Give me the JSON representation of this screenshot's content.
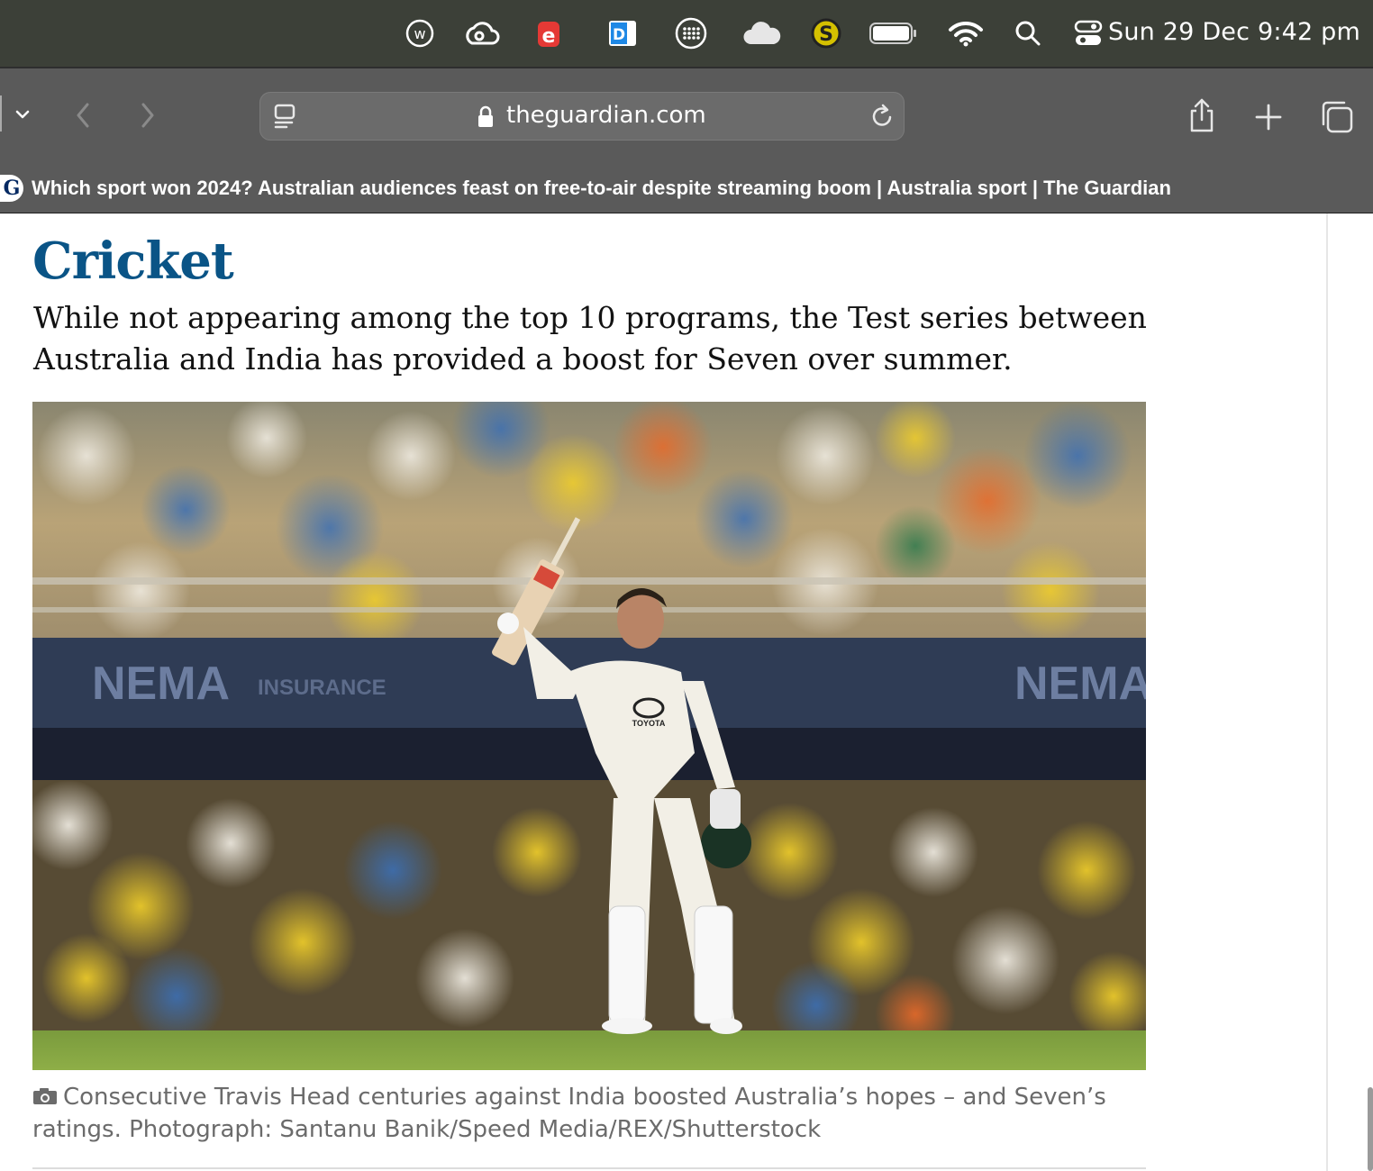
{
  "menubar": {
    "clock": "Sun 29 Dec  9:42 pm",
    "icons": [
      "w-app-icon",
      "creative-cloud-icon",
      "e-app-icon",
      "dashlane-icon",
      "dots-grid-icon",
      "cloud-icon",
      "s-app-icon",
      "battery-icon",
      "wifi-icon",
      "search-icon",
      "control-center-icon"
    ]
  },
  "toolbar": {
    "url": "theguardian.com"
  },
  "tab": {
    "favicon_letter": "G",
    "title": "Which sport won 2024? Australian audiences feast on free-to-air despite streaming boom | Australia sport | The Guardian"
  },
  "article": {
    "heading": "Cricket",
    "lede": "While not appearing among the top 10 programs, the Test series between Australia and India has provided a boost for Seven over summer.",
    "caption": "Consecutive Travis Head centuries against India boosted Australia’s hopes – and Seven’s ratings. Photograph: Santanu Banik/Speed Media/REX/Shutterstock",
    "stand_sign_left": "NEMA",
    "stand_sign_mid": "INSURANCE",
    "stand_sign_right": "NEMA",
    "shirt_sponsor": "TOYOTA"
  },
  "colors": {
    "heading": "#0a5486",
    "menubar_bg": "#3c4038",
    "toolbar_bg": "#5a5a5a"
  }
}
